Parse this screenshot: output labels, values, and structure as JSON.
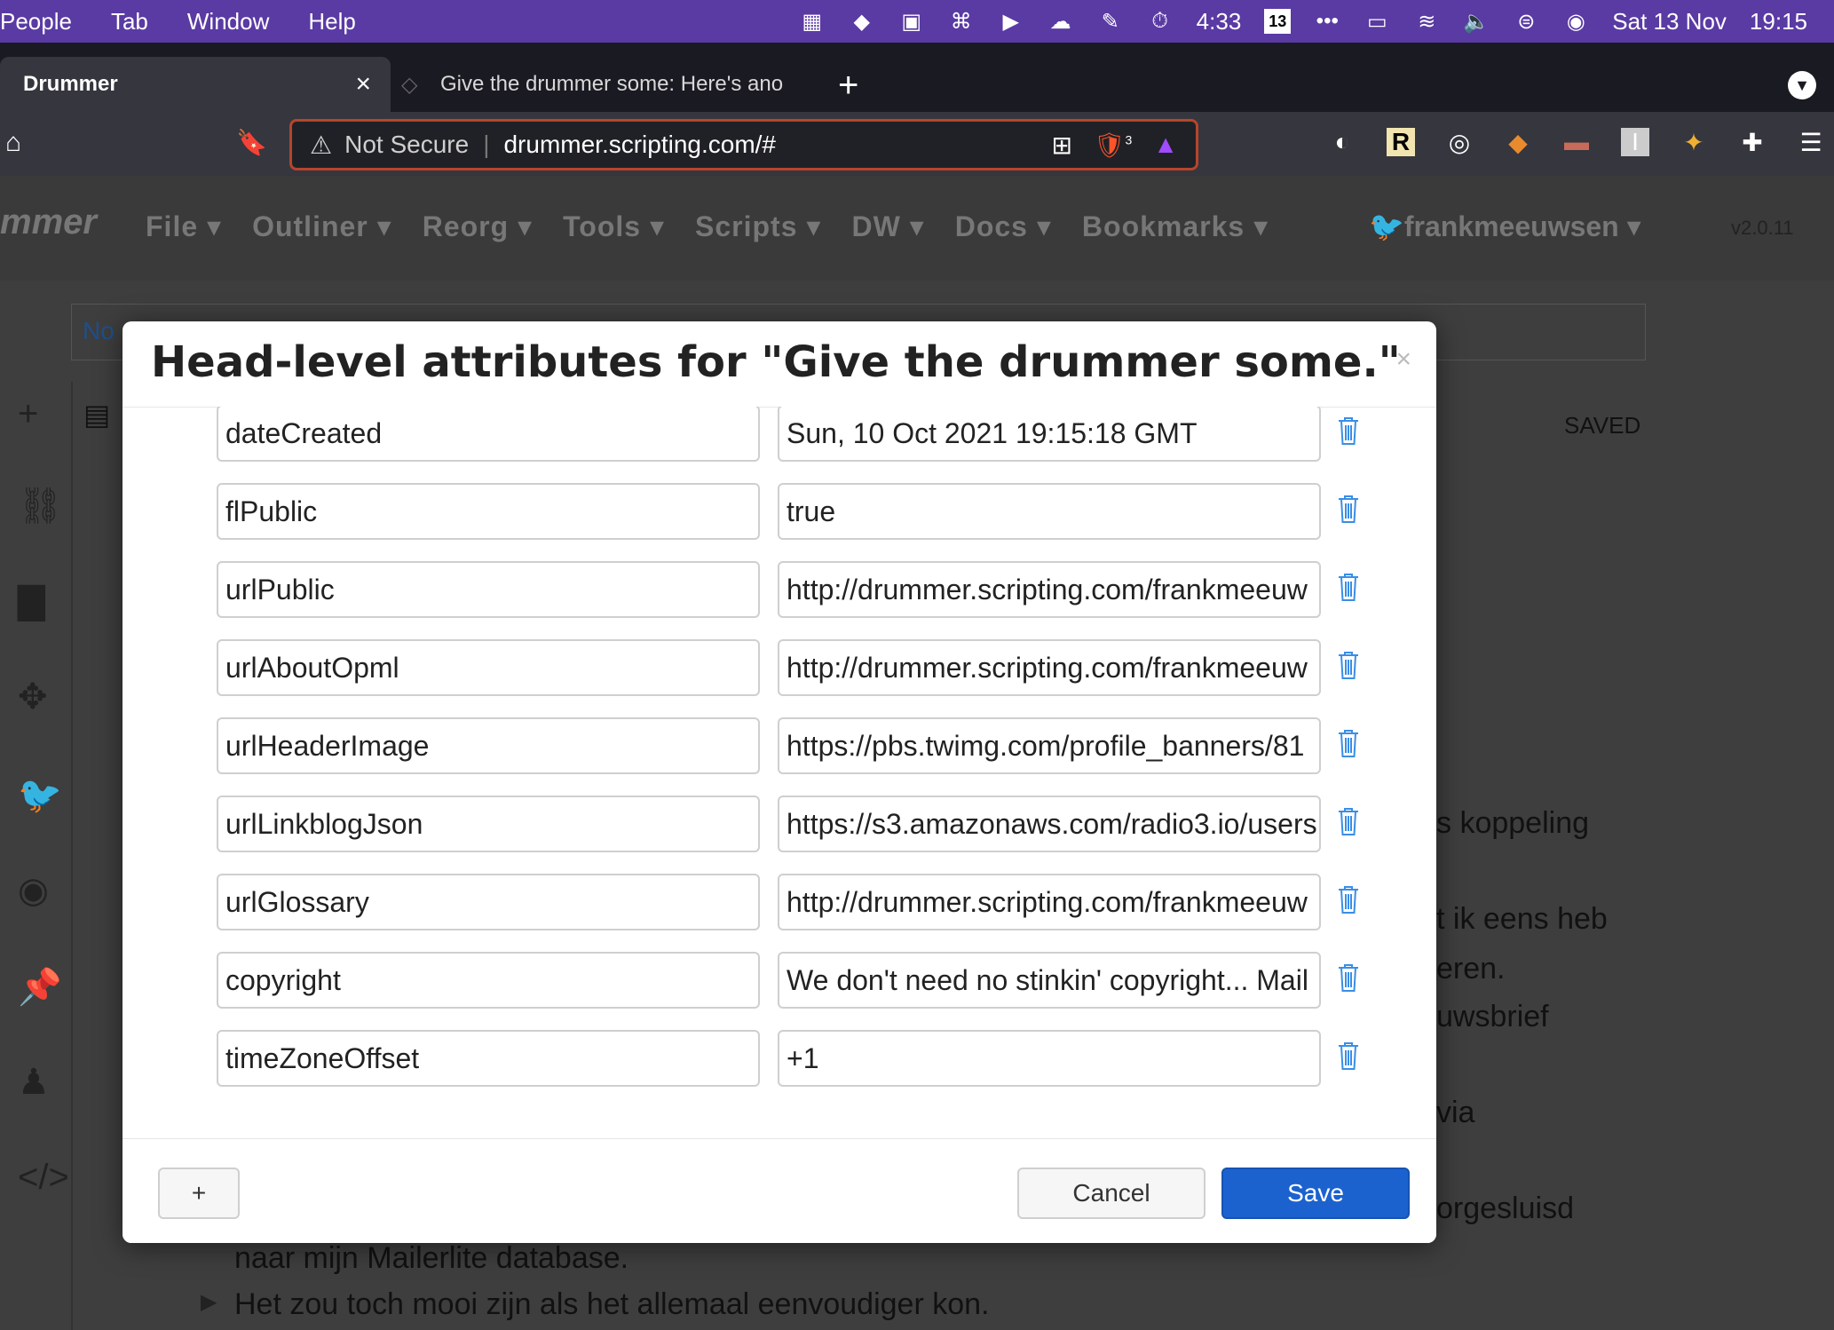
{
  "menubar": {
    "items": [
      "People",
      "Tab",
      "Window",
      "Help"
    ],
    "clock_small": "4:33",
    "calendar_day": "13",
    "date": "Sat 13 Nov",
    "time": "19:15"
  },
  "tabs": [
    {
      "title": "Drummer",
      "active": true
    },
    {
      "title": "Give the drummer some: Here's ano",
      "active": false
    }
  ],
  "toolbar": {
    "security": "Not Secure",
    "url": "drummer.scripting.com/#",
    "brave_badge": "3"
  },
  "app": {
    "brand": "mmer",
    "menus": [
      "File",
      "Outliner",
      "Reorg",
      "Tools",
      "Scripts",
      "DW",
      "Docs",
      "Bookmarks"
    ],
    "user": "frankmeeuwsen",
    "version": "v2.0.11",
    "status": "SAVED",
    "notice_partial": "No",
    "background_lines": [
      "s koppeling",
      "t ik eens heb",
      "eren.",
      "uwsbrief",
      "via",
      "orgesluisd",
      "naar mijn Mailerlite database.",
      "Het zou toch mooi zijn als het allemaal eenvoudiger kon."
    ]
  },
  "modal": {
    "title": "Head-level attributes for \"Give the drummer some.\"",
    "close": "×",
    "attributes": [
      {
        "name": "dateCreated",
        "value": "Sun, 10 Oct 2021 19:15:18 GMT"
      },
      {
        "name": "flPublic",
        "value": "true"
      },
      {
        "name": "urlPublic",
        "value": "http://drummer.scripting.com/frankmeeuw"
      },
      {
        "name": "urlAboutOpml",
        "value": "http://drummer.scripting.com/frankmeeuw"
      },
      {
        "name": "urlHeaderImage",
        "value": "https://pbs.twimg.com/profile_banners/81"
      },
      {
        "name": "urlLinkblogJson",
        "value": "https://s3.amazonaws.com/radio3.io/users"
      },
      {
        "name": "urlGlossary",
        "value": "http://drummer.scripting.com/frankmeeuw"
      },
      {
        "name": "copyright",
        "value": "We don't need no stinkin' copyright... Mail"
      },
      {
        "name": "timeZoneOffset",
        "value": "+1"
      }
    ],
    "add_label": "+",
    "cancel_label": "Cancel",
    "save_label": "Save"
  },
  "colors": {
    "menubar": "#5a3aa3",
    "save_button": "#1c62cf",
    "trash_icon": "#3a8ee6",
    "url_border": "#b5452d"
  }
}
